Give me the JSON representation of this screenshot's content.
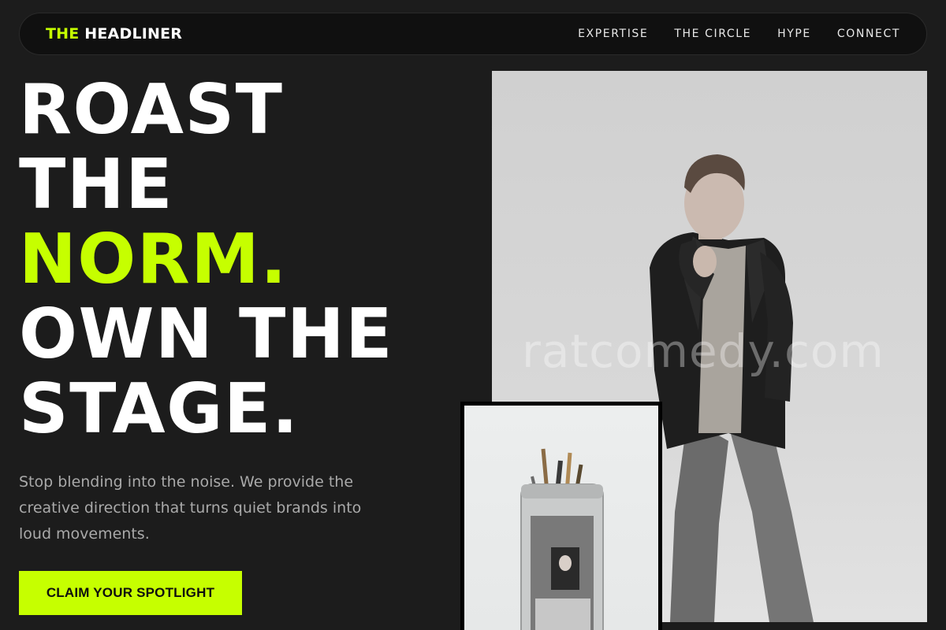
{
  "brand": {
    "accent_word": "THE",
    "name_word": "HEADLINER",
    "accent_color": "#c6ff00"
  },
  "nav": {
    "links": [
      "EXPERTISE",
      "THE CIRCLE",
      "HYPE",
      "CONNECT"
    ]
  },
  "hero": {
    "headline_lines": [
      "ROAST",
      "THE",
      "NORM.",
      "OWN THE",
      "STAGE."
    ],
    "subtext": "Stop blending into the noise. We provide the creative direction that turns quiet brands into loud movements.",
    "cta_label": "CLAIM YOUR SPOTLIGHT"
  },
  "media": {
    "main_photo_watermark": "ratcomedy.com",
    "main_photo_subject": "man-in-blazer-photo",
    "secondary_photo_subject": "brush-jar-photo"
  }
}
